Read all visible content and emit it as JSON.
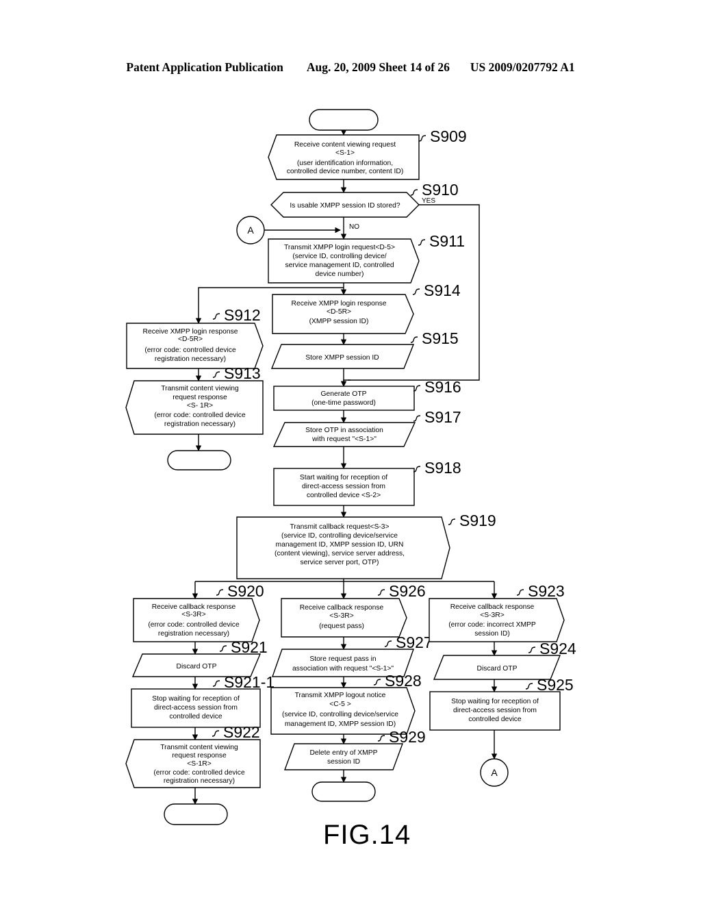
{
  "header": {
    "publication": "Patent Application Publication",
    "date_sheet": "Aug. 20, 2009  Sheet 14 of 26",
    "patent_number": "US 2009/0207792 A1"
  },
  "figure": {
    "label": "FIG.14"
  },
  "connectors": {
    "a_left": "A",
    "a_bottom": "A"
  },
  "branch_labels": {
    "yes": "YES",
    "no": "NO"
  },
  "nodes": {
    "start_top": {
      "step": "",
      "text": ""
    },
    "s909": {
      "step": "S909",
      "lines": [
        "Receive content viewing request",
        "<S-1>",
        "(user identification information,",
        "controlled device number, content ID)"
      ]
    },
    "s910": {
      "step": "S910",
      "lines": [
        "Is usable XMPP session ID stored?"
      ]
    },
    "s911": {
      "step": "S911",
      "lines": [
        "Transmit XMPP login request<D-5>",
        "(service ID, controlling device/",
        "service management ID, controlled",
        "device number)"
      ]
    },
    "s912": {
      "step": "S912",
      "lines": [
        "Receive XMPP login response",
        "<D-5R>",
        "(error code: controlled device",
        "registration necessary)"
      ]
    },
    "s913": {
      "step": "S913",
      "lines": [
        "Transmit content viewing",
        "request response",
        "<S- 1R>",
        "(error code: controlled device",
        "registration necessary)"
      ]
    },
    "s914": {
      "step": "S914",
      "lines": [
        "Receive XMPP login response",
        "<D-5R>",
        "(XMPP session ID)"
      ]
    },
    "s915": {
      "step": "S915",
      "lines": [
        "Store XMPP session ID"
      ]
    },
    "s916": {
      "step": "S916",
      "lines": [
        "Generate OTP",
        "(one-time password)"
      ]
    },
    "s917": {
      "step": "S917",
      "lines": [
        "Store OTP in association",
        "with request \"<S-1>\""
      ]
    },
    "s918": {
      "step": "S918",
      "lines": [
        "Start waiting for reception of",
        "direct-access session from",
        "controlled device <S-2>"
      ]
    },
    "s919": {
      "step": "S919",
      "lines": [
        "Transmit callback request<S-3>",
        "(service ID, controlling device/service",
        "management ID, XMPP session ID, URN",
        "(content viewing), service server address,",
        "service server port, OTP)"
      ]
    },
    "s920": {
      "step": "S920",
      "lines": [
        "Receive callback response",
        "<S-3R>",
        "(error code: controlled device",
        "registration necessary)"
      ]
    },
    "s921": {
      "step": "S921",
      "lines": [
        "Discard OTP"
      ]
    },
    "s921_1": {
      "step": "S921-1",
      "lines": [
        "Stop waiting for reception of",
        "direct-access session from",
        "controlled device"
      ]
    },
    "s922": {
      "step": "S922",
      "lines": [
        "Transmit content viewing",
        "request response",
        "<S-1R>",
        "(error code: controlled device",
        "registration necessary)"
      ]
    },
    "s923": {
      "step": "S923",
      "lines": [
        "Receive callback response",
        "<S-3R>",
        "(error code: incorrect XMPP",
        "session ID)"
      ]
    },
    "s924": {
      "step": "S924",
      "lines": [
        "Discard OTP"
      ]
    },
    "s925": {
      "step": "S925",
      "lines": [
        "Stop waiting for reception of",
        "direct-access session from",
        "controlled device"
      ]
    },
    "s926": {
      "step": "S926",
      "lines": [
        "Receive callback response",
        "<S-3R>",
        "(request pass)"
      ]
    },
    "s927": {
      "step": "S927",
      "lines": [
        "Store request pass in",
        "association with request \"<S-1>\""
      ]
    },
    "s928": {
      "step": "S928",
      "lines": [
        "Transmit XMPP logout notice",
        "<C-5 >",
        "(service ID, controlling device/service",
        "management ID, XMPP session ID)"
      ]
    },
    "s929": {
      "step": "S929",
      "lines": [
        "Delete entry of XMPP",
        "session ID"
      ]
    }
  }
}
